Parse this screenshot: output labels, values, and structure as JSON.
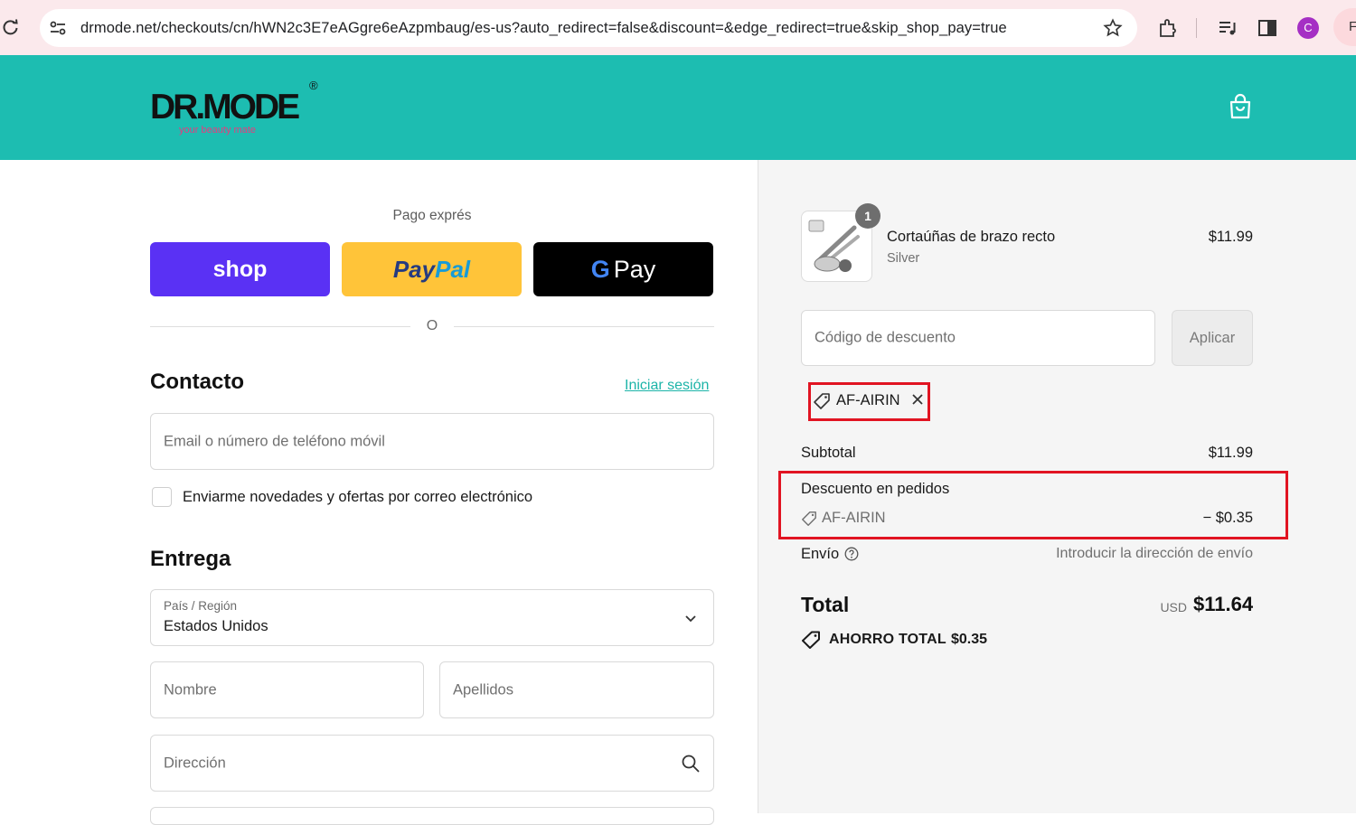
{
  "browser": {
    "url": "drmode.net/checkouts/cn/hWN2c3E7eAGgre6eAzpmbaug/es-us?auto_redirect=false&discount=&edge_redirect=true&skip_shop_pay=true",
    "profile_initial": "C",
    "profile_pill_text": "F"
  },
  "header": {
    "logo_text": "DR.MODE",
    "logo_tagline": "your beauty mate",
    "logo_reg": "®",
    "cart_icon": "shopping-bag-icon",
    "bg_color": "#1dbdb1"
  },
  "express": {
    "label": "Pago exprés",
    "shop_label": "shop",
    "paypal_part1": "Pay",
    "paypal_part2": "Pal",
    "gpay_g": "G",
    "gpay_label": "Pay",
    "divider_text": "O"
  },
  "contact": {
    "title": "Contacto",
    "login_link": "Iniciar sesión",
    "email_placeholder": "Email o número de teléfono móvil",
    "newsletter_label": "Enviarme novedades y ofertas por correo electrónico"
  },
  "delivery": {
    "title": "Entrega",
    "country_label": "País / Región",
    "country_value": "Estados Unidos",
    "first_name_placeholder": "Nombre",
    "last_name_placeholder": "Apellidos",
    "address_placeholder": "Dirección"
  },
  "summary": {
    "item": {
      "quantity": "1",
      "name": "Cortaúñas de brazo recto",
      "variant": "Silver",
      "price": "$11.99"
    },
    "discount_placeholder": "Código de descuento",
    "apply_label": "Aplicar",
    "applied_code": "AF-AIRIN",
    "subtotal_label": "Subtotal",
    "subtotal_value": "$11.99",
    "order_discount_label": "Descuento en pedidos",
    "order_discount_code": "AF-AIRIN",
    "order_discount_value": "− $0.35",
    "shipping_label": "Envío",
    "shipping_value": "Introducir la dirección de envío",
    "total_label": "Total",
    "currency": "USD",
    "total_value": "$11.64",
    "savings_label": "AHORRO TOTAL",
    "savings_value": "$0.35"
  },
  "colors": {
    "accent": "#1cb4a8",
    "highlight_border": "#e11422",
    "shop_pay": "#5a31f4",
    "paypal": "#ffc439"
  }
}
